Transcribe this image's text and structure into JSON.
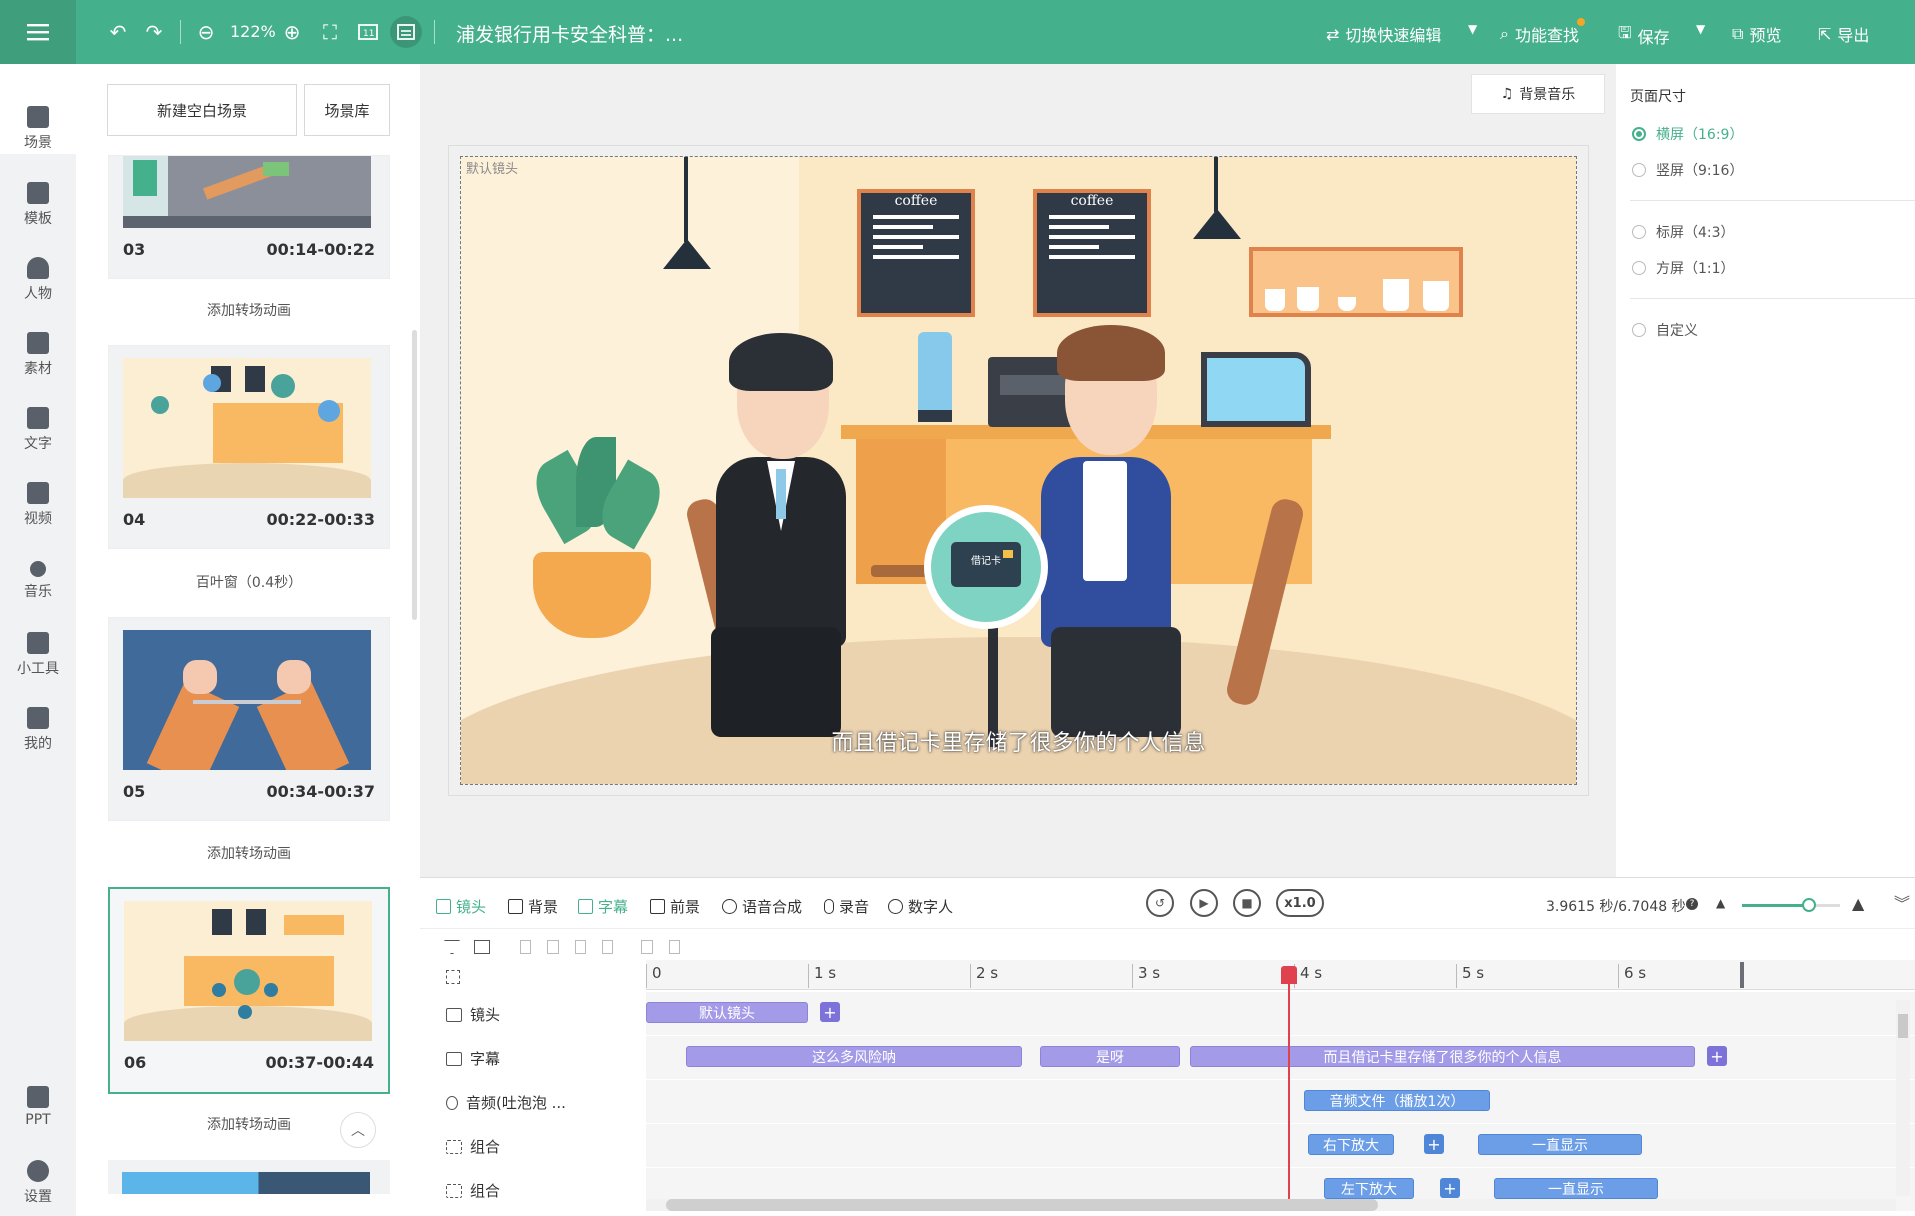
{
  "topbar": {
    "zoom": "122%",
    "title": "浦发银行用卡安全科普：...",
    "quick_edit": "切换快速编辑",
    "search_feature": "功能查找",
    "save": "保存",
    "preview": "预览",
    "export": "导出"
  },
  "leftnav": {
    "items": [
      "场景",
      "模板",
      "人物",
      "素材",
      "文字",
      "视频",
      "音乐",
      "小工具",
      "我的"
    ],
    "ppt": "PPT",
    "settings": "设置"
  },
  "scenes": {
    "new_blank": "新建空白场景",
    "library": "场景库",
    "cards": [
      {
        "num": "03",
        "time": "00:14-00:22"
      },
      {
        "num": "04",
        "time": "00:22-00:33"
      },
      {
        "num": "05",
        "time": "00:34-00:37"
      },
      {
        "num": "06",
        "time": "00:37-00:44"
      }
    ],
    "transitions": [
      "添加转场动画",
      "百叶窗（0.4秒）",
      "添加转场动画",
      "添加转场动画"
    ]
  },
  "canvas": {
    "bg_music": "背景音乐",
    "camera_label": "默认镜头",
    "subtitle": "而且借记卡里存储了很多你的个人信息",
    "coffee_sign": "coffee",
    "card_text": "借记卡"
  },
  "page_size": {
    "title": "页面尺寸",
    "options": [
      "横屏（16:9）",
      "竖屏（9:16）",
      "标屏（4:3）",
      "方屏（1:1）",
      "自定义"
    ],
    "selected": "横屏（16:9）"
  },
  "timeline": {
    "tabs": [
      "镜头",
      "背景",
      "字幕",
      "前景",
      "语音合成",
      "录音",
      "数字人"
    ],
    "active_tab": "字幕",
    "speed": "x1.0",
    "time_readout": "3.9615 秒/6.7048 秒",
    "ticks": [
      "0",
      "1 s",
      "2 s",
      "3 s",
      "4 s",
      "5 s",
      "6 s"
    ],
    "rows": [
      "镜头",
      "字幕",
      "音频(吐泡泡 ...",
      "组合",
      "组合"
    ],
    "clips": {
      "camera": "默认镜头",
      "sub1": "这么多风险呐",
      "sub2": "是呀",
      "sub3": "而且借记卡里存储了很多你的个人信息",
      "audio": "音频文件（播放1次）",
      "g1a": "右下放大",
      "g1b": "一直显示",
      "g2a": "左下放大",
      "g2b": "一直显示"
    }
  },
  "colors": {
    "brand": "#45b08c",
    "playhead": "#e0414f"
  }
}
